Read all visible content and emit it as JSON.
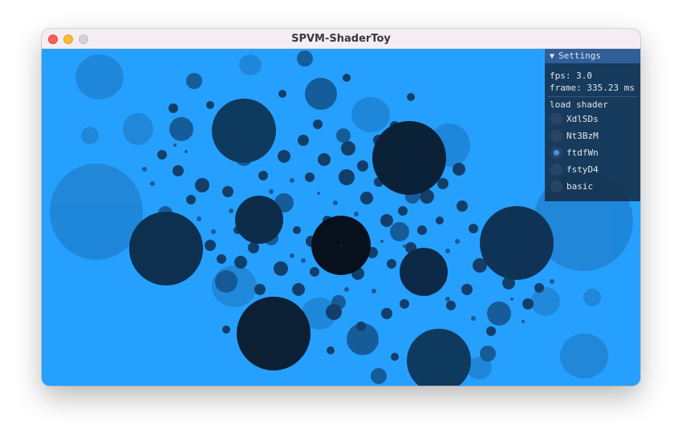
{
  "window": {
    "title": "SPVM-ShaderToy"
  },
  "settings": {
    "header": "Settings",
    "fps_text": "fps: 3.0",
    "frame_text": "frame: 335.23 ms",
    "load_label": "load shader",
    "shaders": [
      {
        "label": "XdlSDs",
        "selected": false
      },
      {
        "label": "Nt3BzM",
        "selected": false
      },
      {
        "label": "ftdfWn",
        "selected": true
      },
      {
        "label": "fstyD4",
        "selected": false
      },
      {
        "label": "basic",
        "selected": false
      }
    ]
  },
  "colors": {
    "background": "#26a0ff",
    "panel": "#162c46",
    "panel_header": "#2f5e98",
    "radio_selected": "#4a90e6"
  }
}
